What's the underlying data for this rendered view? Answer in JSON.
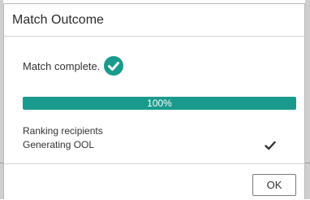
{
  "dialog": {
    "title": "Match Outcome"
  },
  "status": {
    "text": "Match complete.",
    "icon": "check-circle-icon",
    "icon_color": "#1a9a8c"
  },
  "progress": {
    "value": 1.0,
    "label": "100%",
    "fill_color": "#1a9a8c"
  },
  "steps": [
    {
      "label": "Ranking recipients"
    },
    {
      "label": "Generating OOL",
      "done_icon": "checkmark-icon"
    }
  ],
  "footer": {
    "ok_label": "OK"
  }
}
